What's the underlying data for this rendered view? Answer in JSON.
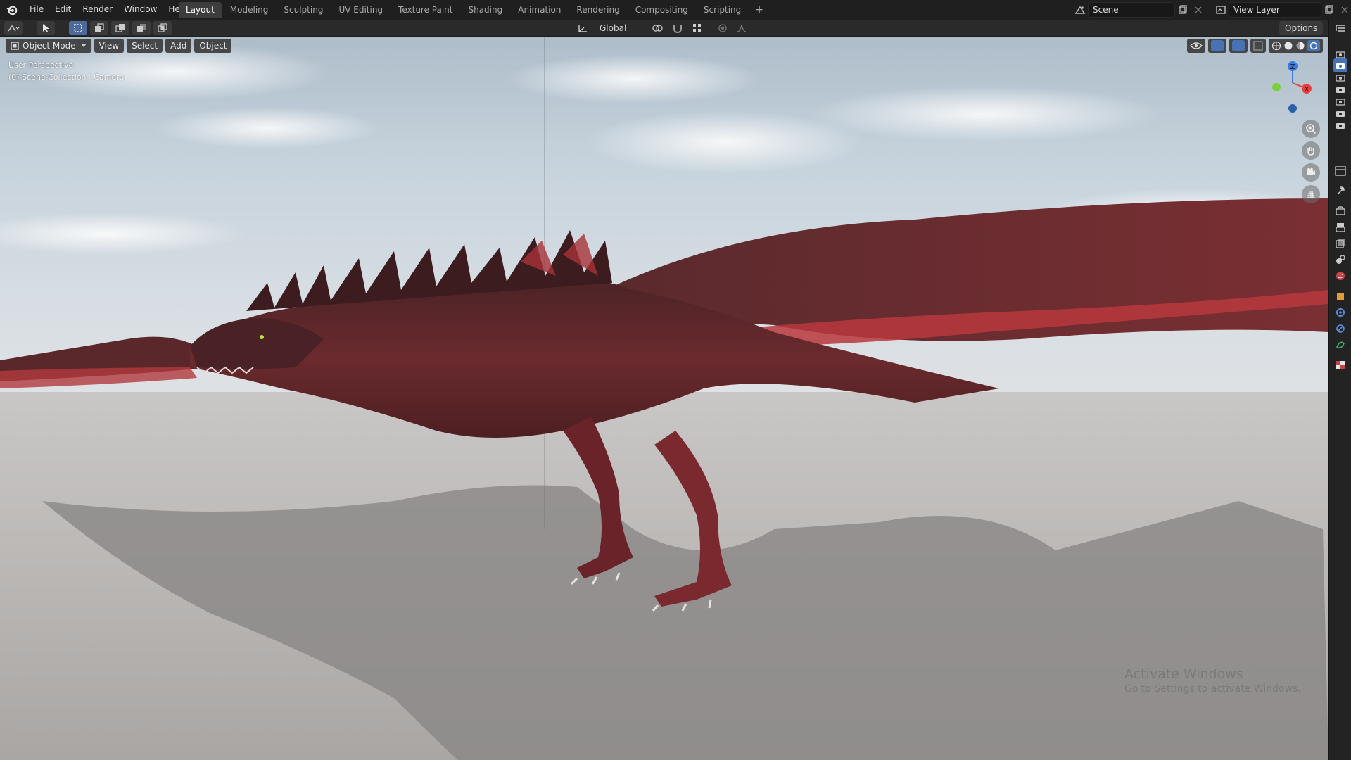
{
  "menu": {
    "items": [
      "File",
      "Edit",
      "Render",
      "Window",
      "Help"
    ]
  },
  "workspaces": {
    "tabs": [
      "Layout",
      "Modeling",
      "Sculpting",
      "UV Editing",
      "Texture Paint",
      "Shading",
      "Animation",
      "Rendering",
      "Compositing",
      "Scripting"
    ],
    "active": "Layout",
    "add_label": "+"
  },
  "scene": {
    "name": "Scene"
  },
  "view_layer": {
    "name": "View Layer"
  },
  "toolbar": {
    "transform_orientation": "Global",
    "options_label": "Options"
  },
  "viewport": {
    "mode": "Object Mode",
    "menus": [
      "View",
      "Select",
      "Add",
      "Object"
    ],
    "info_line1": "User Perspective",
    "info_line2": "(0) Scene Collection | Camera",
    "gizmo": {
      "z_label": "Z",
      "x_label": "X"
    }
  },
  "watermark": {
    "title": "Activate Windows",
    "subtitle": "Go to Settings to activate Windows."
  },
  "colors": {
    "accent": "#4772b3",
    "axis_x": "#e8413d",
    "axis_y": "#7ccf3c",
    "axis_z": "#3b7ddd",
    "dragon_red": "#8a2a2e"
  },
  "icons": {
    "logo": "blender-logo-icon",
    "properties": [
      "tool-icon",
      "render-icon",
      "output-icon",
      "view-layer-icon",
      "scene-icon",
      "world-icon",
      "object-icon",
      "modifier-icon",
      "physics-icon",
      "constraint-icon",
      "data-icon",
      "texture-icon"
    ]
  }
}
